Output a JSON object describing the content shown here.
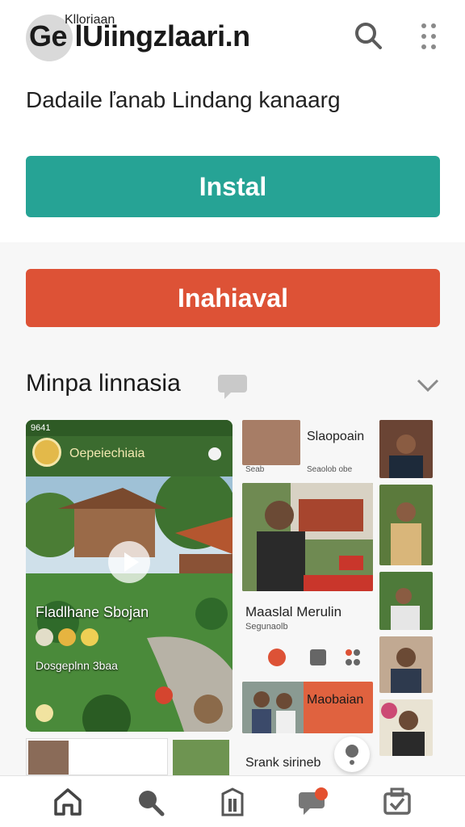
{
  "header": {
    "title": "Ge lUiingzlaari.n",
    "search_icon": "search-icon",
    "more_icon": "more-vert-icon"
  },
  "subtitle": "Dadaile ľanab Lindang kanaarg",
  "buttons": {
    "primary": "Instal",
    "secondary": "Inahiaval"
  },
  "section": {
    "title": "Minpa linnasia"
  },
  "feed": {
    "main_card": {
      "status": "9641",
      "channel": "Oepeiechiaia",
      "title": "Fladlhane Sbojan",
      "meta": "Dosgeplnn 3baa"
    },
    "middle": [
      {
        "title": "Slaopoain",
        "meta_left": "Seab",
        "meta_right": "Seaolob obe"
      },
      {
        "title": "Maaslal Merulin",
        "meta": "Segunaolb"
      },
      {
        "title": "Maobaian"
      },
      {
        "title": "Srank sirineb"
      }
    ],
    "bottom_card": {
      "title": "Klloriaan"
    }
  },
  "colors": {
    "primary": "#26a395",
    "secondary": "#dd5236",
    "nav_notification": "#e4502f"
  },
  "bottom_nav": [
    {
      "icon": "home-icon"
    },
    {
      "icon": "search-icon"
    },
    {
      "icon": "library-icon"
    },
    {
      "icon": "chat-icon"
    },
    {
      "icon": "inbox-icon"
    }
  ]
}
